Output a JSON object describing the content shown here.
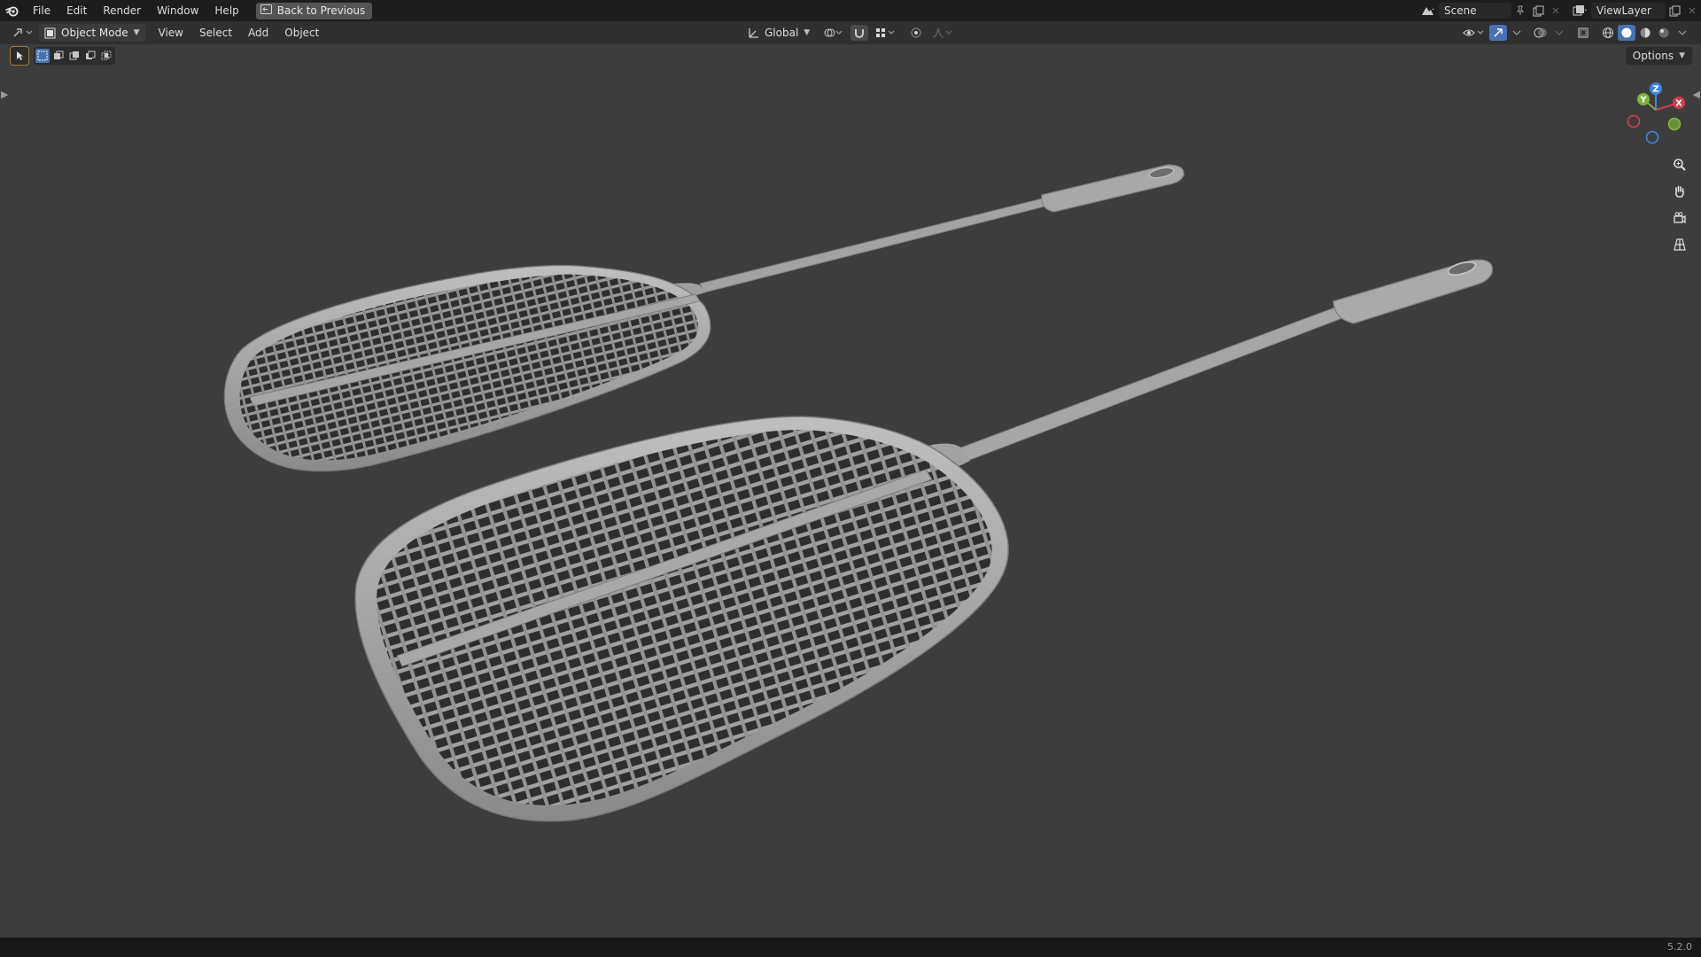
{
  "topbar": {
    "menu": [
      "File",
      "Edit",
      "Render",
      "Window",
      "Help"
    ],
    "back_button": "Back to Previous",
    "scene_name": "Scene",
    "view_layer": "ViewLayer"
  },
  "header": {
    "mode": "Object Mode",
    "menus": [
      "View",
      "Select",
      "Add",
      "Object"
    ],
    "transform_orientation": "Global"
  },
  "viewport": {
    "options_label": "Options",
    "gizmo_axes": {
      "x": "X",
      "y": "Y",
      "z": "Z"
    },
    "objects": [
      "fly-swatter-small",
      "fly-swatter-large"
    ],
    "colors": {
      "background": "#3d3d3d",
      "model": "#9a9a9a",
      "axis_x": "#d63c4b",
      "axis_y": "#7fb53a",
      "axis_z": "#3d86e0"
    }
  },
  "statusbar": {
    "version": "5.2.0"
  }
}
